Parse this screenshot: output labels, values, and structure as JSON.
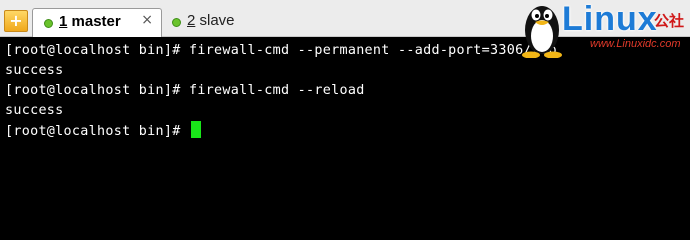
{
  "tabbar": {
    "add_button_icon": "plus-icon",
    "tabs": [
      {
        "number": "1",
        "name": " master",
        "status": "connected",
        "close_symbol": "×"
      },
      {
        "number": "2",
        "name": " slave",
        "status": "connected"
      }
    ],
    "status_color": "#6ac32c"
  },
  "terminal": {
    "lines": [
      "[root@localhost bin]# firewall-cmd --permanent --add-port=3306/tcp",
      "success",
      "[root@localhost bin]# firewall-cmd --reload",
      "success",
      "[root@localhost bin]# "
    ],
    "cursor_color": "#19e619"
  },
  "watermark": {
    "brand": "Linux",
    "brand_cn": "公社",
    "url": "www.Linuxidc.com",
    "icon": "tux-penguin-icon"
  }
}
